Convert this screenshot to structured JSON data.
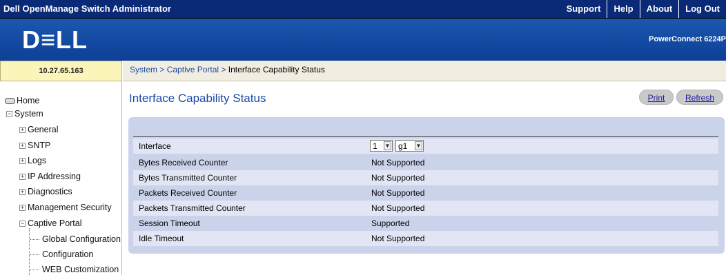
{
  "header": {
    "app_title": "Dell OpenManage Switch Administrator",
    "links": [
      "Support",
      "Help",
      "About",
      "Log Out"
    ]
  },
  "banner": {
    "logo": "D≡LL",
    "product": "PowerConnect 6224P"
  },
  "ip_address": "10.27.65.163",
  "breadcrumb": {
    "system": "System",
    "captive_portal": "Captive Portal",
    "current": "Interface Capability Status",
    "separator": ">"
  },
  "sidebar": {
    "home": "Home",
    "system": "System",
    "items": [
      "General",
      "SNTP",
      "Logs",
      "IP Addressing",
      "Diagnostics",
      "Management Security",
      "Captive Portal"
    ],
    "sub_items": [
      "Global Configuration",
      "Configuration",
      "WEB Customization"
    ]
  },
  "main": {
    "title": "Interface Capability Status",
    "print_label": "Print",
    "refresh_label": "Refresh",
    "interface_label": "Interface",
    "unit_value": "1",
    "port_value": "g1",
    "rows": [
      {
        "label": "Bytes Received Counter",
        "value": "Not Supported"
      },
      {
        "label": "Bytes Transmitted Counter",
        "value": "Not Supported"
      },
      {
        "label": "Packets Received Counter",
        "value": "Not Supported"
      },
      {
        "label": "Packets Transmitted Counter",
        "value": "Not Supported"
      },
      {
        "label": "Session Timeout",
        "value": "Supported"
      },
      {
        "label": "Idle Timeout",
        "value": "Not Supported"
      }
    ]
  },
  "icons": {
    "home": "home-icon",
    "expand": "plus-box-icon",
    "collapse": "minus-box-icon",
    "dropdown": "chevron-down-icon"
  },
  "colors": {
    "topbar": "#0a2a78",
    "banner": "#1a58b0",
    "panel": "#cad3ea",
    "link": "#1a4aa4"
  }
}
